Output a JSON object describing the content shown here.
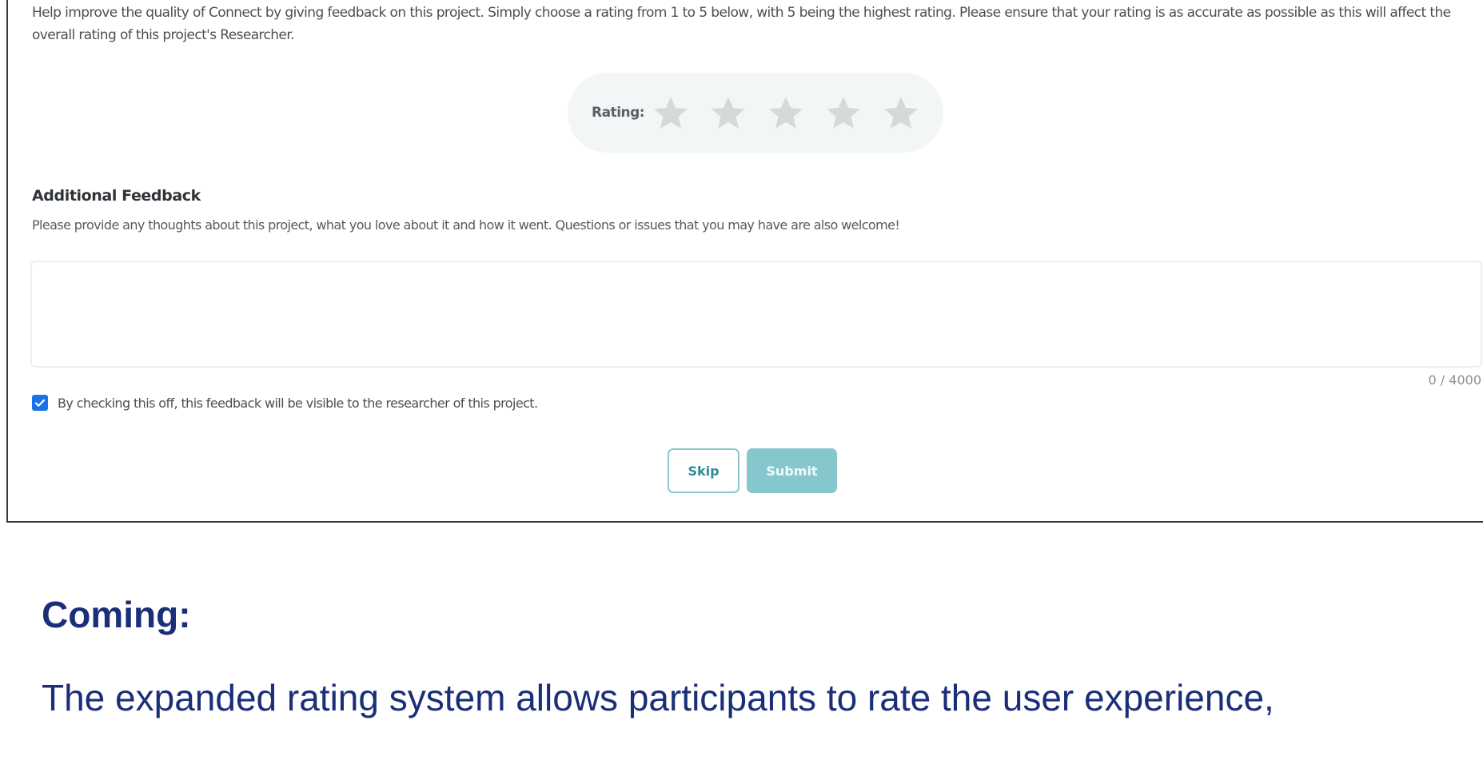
{
  "feedback_form": {
    "intro_text": "Help improve the quality of Connect by giving feedback on this project. Simply choose a rating from 1 to 5 below, with 5 being the highest rating. Please ensure that your rating is as accurate as possible as this will affect the overall rating of this project's Researcher.",
    "rating": {
      "label": "Rating:",
      "max_stars": 5,
      "selected": 0,
      "star_color": "#d6d8da"
    },
    "additional_feedback": {
      "title": "Additional Feedback",
      "description": "Please provide any thoughts about this project, what you love about it and how it went. Questions or issues that you may have are also welcome!",
      "value": "",
      "counter": "0 / 4000"
    },
    "visibility_checkbox": {
      "checked": true,
      "label": "By checking this off, this feedback will be visible to the researcher of this project."
    },
    "buttons": {
      "skip_label": "Skip",
      "submit_label": "Submit"
    }
  },
  "slide": {
    "heading": "Coming:",
    "body": "The expanded rating system allows participants to rate the user experience,"
  },
  "colors": {
    "accent_teal": "#86c7cd",
    "checkbox_blue": "#1a73e8",
    "slide_navy": "#1a2f78"
  }
}
